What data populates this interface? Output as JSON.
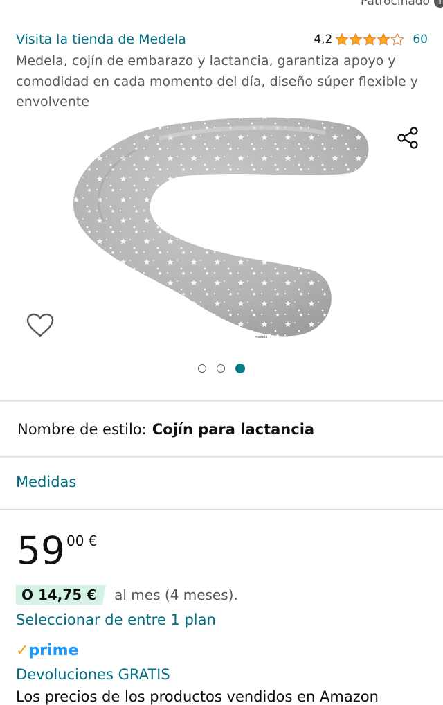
{
  "sponsored": {
    "label": "Patrocinado",
    "info_icon": "i"
  },
  "store": {
    "link": "Visita la tienda de Medela"
  },
  "rating": {
    "value": "4,2",
    "stars": 4.2,
    "count": "60"
  },
  "product": {
    "title": "Medela, cojín de embarazo y lactancia, garantiza apoyo y comodidad en cada momento del día, diseño súper flexible y envolvente",
    "image_icon": "nursing-pillow-image",
    "image_logo": "medela"
  },
  "carousel": {
    "count": 3,
    "active_index": 2
  },
  "style": {
    "label": "Nombre de estilo:",
    "value": "Cojín para lactancia"
  },
  "measures": {
    "label": "Medidas"
  },
  "price": {
    "whole": "59",
    "fraction": "00 €"
  },
  "installment": {
    "badge": "O 14,75 €",
    "text": "al mes (4 meses)."
  },
  "plan": {
    "link": "Seleccionar de entre 1 plan"
  },
  "prime": {
    "label": "prime",
    "check": "✓"
  },
  "returns": {
    "label": "Devoluciones GRATIS"
  },
  "footer": {
    "text": "Los precios de los productos vendidos en Amazon"
  },
  "colors": {
    "link": "#007185",
    "accent": "#067d87",
    "star": "#ffa41c",
    "prime": "#1a98ff",
    "installment_bg": "#d5f3e4"
  }
}
